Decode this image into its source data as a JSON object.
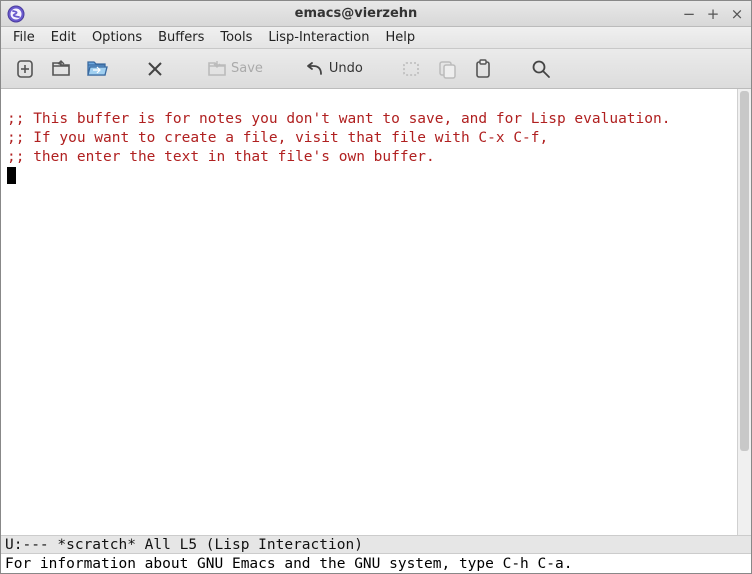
{
  "window": {
    "title": "emacs@vierzehn"
  },
  "menu": {
    "items": [
      "File",
      "Edit",
      "Options",
      "Buffers",
      "Tools",
      "Lisp-Interaction",
      "Help"
    ]
  },
  "toolbar": {
    "save_label": "Save",
    "undo_label": "Undo"
  },
  "buffer": {
    "line1": ";; This buffer is for notes you don't want to save, and for Lisp evaluation.",
    "line2": ";; If you want to create a file, visit that file with C-x C-f,",
    "line3": ";; then enter the text in that file's own buffer."
  },
  "modeline": {
    "left": "U:---  *scratch*      All L5     (Lisp Interaction)"
  },
  "minibuffer": {
    "text": "For information about GNU Emacs and the GNU system, type C-h C-a."
  }
}
